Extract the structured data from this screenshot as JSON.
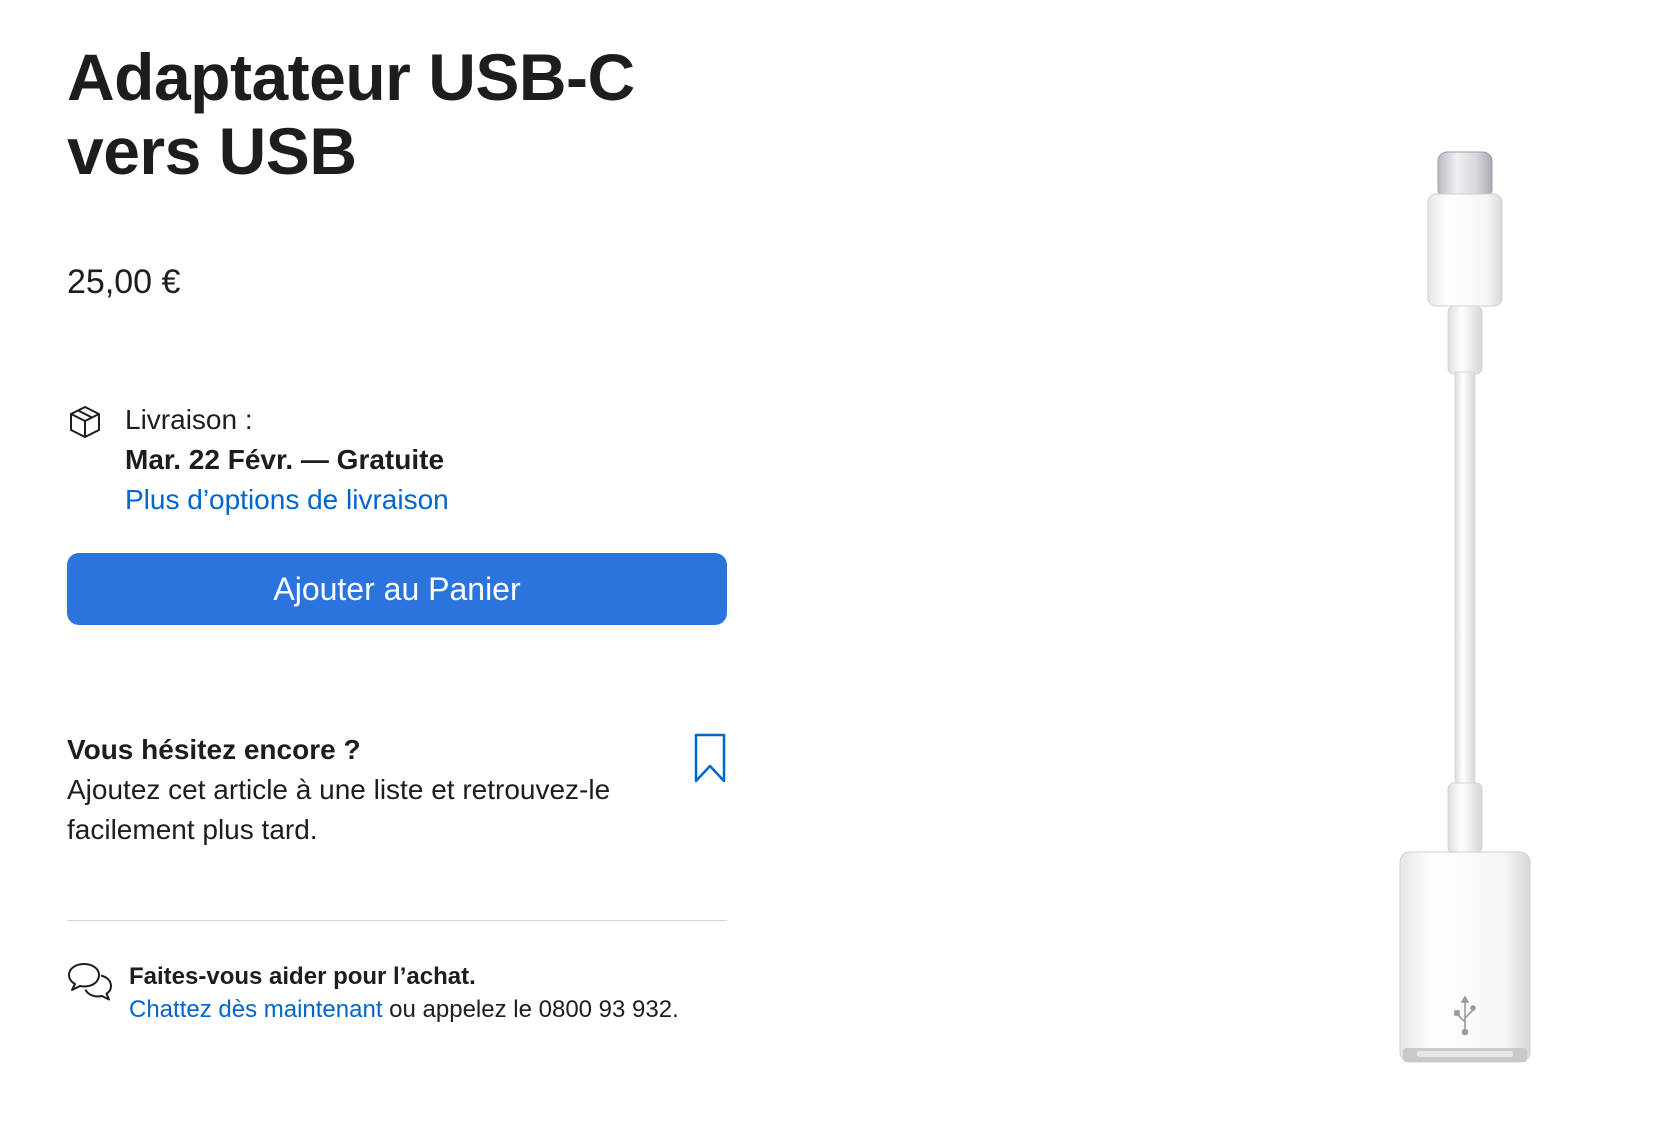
{
  "product": {
    "title": "Adaptateur USB‑C vers USB",
    "price": "25,00 €"
  },
  "delivery": {
    "icon": "box-icon",
    "label": "Livraison :",
    "date": "Mar. 22 Févr. — Gratuite",
    "more_options_link": "Plus d’options de livraison"
  },
  "cart": {
    "add_button_label": "Ajouter au Panier",
    "button_color": "#2c74dd"
  },
  "saved_list": {
    "icon": "bookmark-icon",
    "title": "Vous hésitez encore ?",
    "text": "Ajoutez cet article à une liste et retrouvez-le facilement plus tard."
  },
  "help": {
    "icon": "chat-bubbles-icon",
    "title": "Faites-vous aider pour l’achat.",
    "chat_link": "Chattez dès maintenant",
    "call_text": " ou appelez le 0800 93 932."
  },
  "colors": {
    "link": "#0066cc",
    "text": "#1d1d1f"
  }
}
